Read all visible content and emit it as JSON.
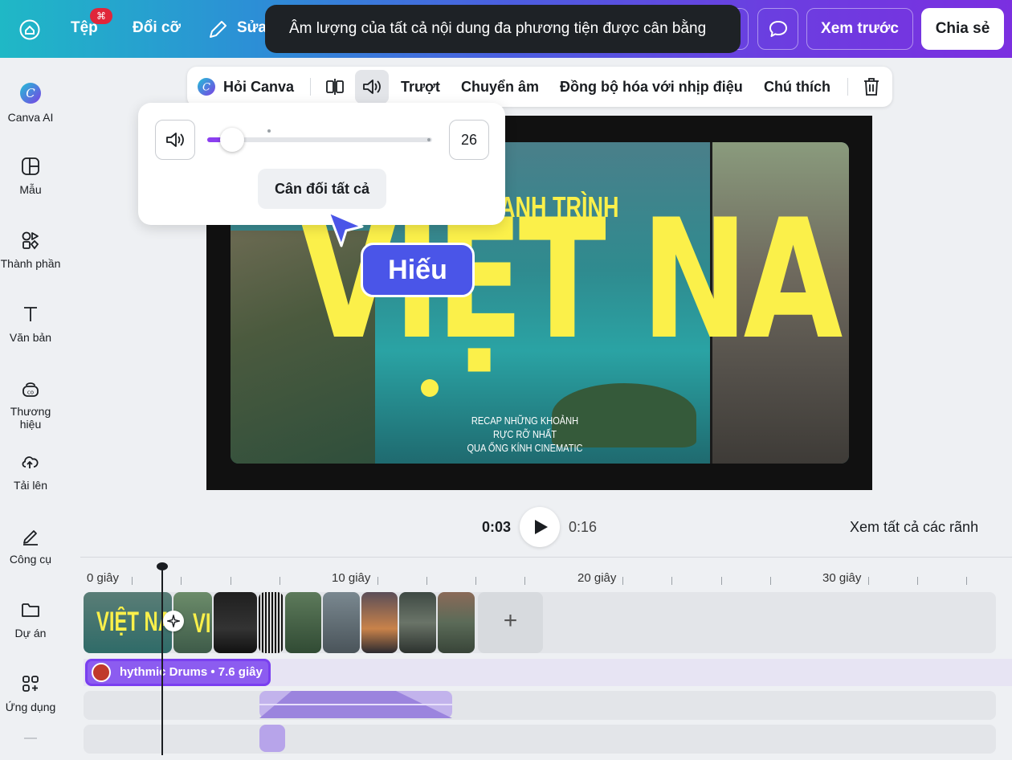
{
  "topbar": {
    "file_label": "Tệp",
    "file_badge": "⌘",
    "resize_label": "Đổi cỡ",
    "edit_label": "Sửa",
    "toast": "Âm lượng của tất cả nội dung đa phương tiện được cân bằng",
    "preview_label": "Xem trước",
    "share_label": "Chia sẻ"
  },
  "sidebar": {
    "items": [
      {
        "label": "Canva AI",
        "icon": "canva-ai-icon"
      },
      {
        "label": "Mẫu",
        "icon": "template-icon"
      },
      {
        "label": "Thành phần",
        "icon": "elements-icon"
      },
      {
        "label": "Văn bản",
        "icon": "text-icon"
      },
      {
        "label": "Thương hiệu",
        "icon": "brand-icon"
      },
      {
        "label": "Tải lên",
        "icon": "upload-icon"
      },
      {
        "label": "Công cụ",
        "icon": "tools-icon"
      },
      {
        "label": "Dự án",
        "icon": "folder-icon"
      },
      {
        "label": "Ứng dụng",
        "icon": "apps-icon"
      }
    ]
  },
  "context_toolbar": {
    "ask_canva": "Hỏi Canva",
    "slide": "Trượt",
    "transcribe": "Chuyển âm",
    "sync_beat": "Đồng bộ hóa với nhịp điệu",
    "caption": "Chú thích"
  },
  "canvas": {
    "subtitle": "ANH TRÌNH",
    "title": "VIỆT NAM",
    "recap_line1": "RECAP NHỮNG KHOẢNH RỰC RỠ NHẤT",
    "recap_line2": "QUA ỐNG KÍNH CINEMATIC"
  },
  "volume_popover": {
    "value": "26",
    "level_percent": 26,
    "balance_all": "Cân đối tất cả"
  },
  "collaborator": {
    "name": "Hiếu",
    "color": "#4a55e8"
  },
  "playback": {
    "current": "0:03",
    "total": "0:16",
    "see_all_tracks": "Xem tất cả các rãnh"
  },
  "timeline": {
    "labels": [
      "0 giây",
      "10 giây",
      "20 giây",
      "30 giây"
    ],
    "clip_title": "VIỆT NA",
    "audio_clip": "hythmic Drums • 7.6 giây"
  },
  "colors": {
    "accent": "#8b3ff0",
    "title_yellow": "#fbf04a",
    "toast_bg": "#1e2226"
  }
}
